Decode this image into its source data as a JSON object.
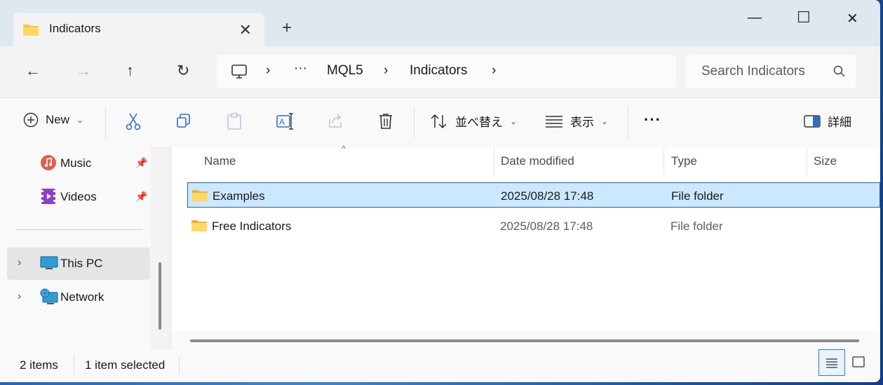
{
  "tab": {
    "title": "Indicators",
    "close": "✕",
    "new": "+"
  },
  "window_controls": {
    "minimize": "—",
    "maximize": "☐",
    "close": "✕"
  },
  "nav": {
    "back": "←",
    "forward": "→",
    "up": "↑",
    "refresh": "↻",
    "breadcrumb": {
      "more": "···",
      "chevron": "›",
      "items": [
        "MQL5",
        "Indicators"
      ]
    }
  },
  "search": {
    "placeholder": "Search Indicators"
  },
  "commands": {
    "new": "New",
    "sort": "並べ替え",
    "view": "表示",
    "more": "···",
    "details": "詳細"
  },
  "sidebar": {
    "pinned": [
      {
        "label": "Music"
      },
      {
        "label": "Videos"
      }
    ],
    "items": [
      {
        "label": "This PC",
        "selected": true
      },
      {
        "label": "Network",
        "selected": false
      }
    ]
  },
  "columns": [
    "Name",
    "Date modified",
    "Type",
    "Size"
  ],
  "files": [
    {
      "name": "Examples",
      "date": "2025/08/28 17:48",
      "type": "File folder",
      "size": "",
      "selected": true
    },
    {
      "name": "Free Indicators",
      "date": "2025/08/28 17:48",
      "type": "File folder",
      "size": "",
      "selected": false
    }
  ],
  "status": {
    "count": "2 items",
    "selection": "1 item selected"
  },
  "colors": {
    "selection": "#cce8ff",
    "selection_border": "#2c628b",
    "folder": "#f4c542"
  }
}
